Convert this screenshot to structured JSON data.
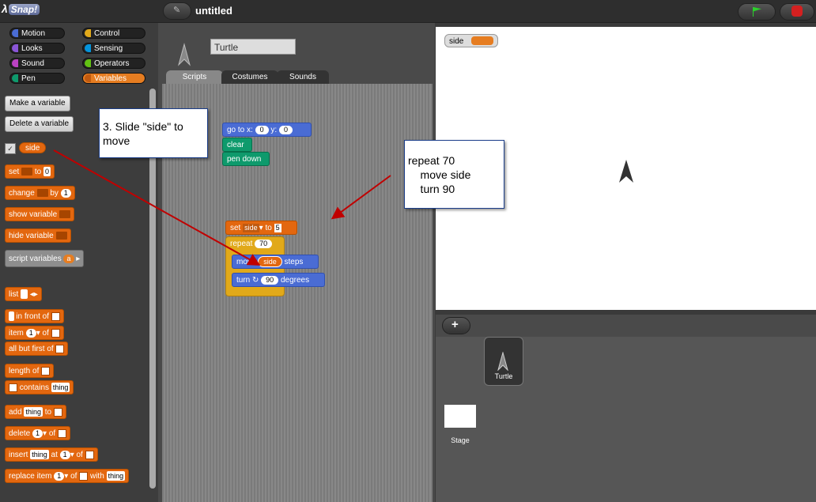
{
  "app": {
    "logo_text": "Snap!"
  },
  "toolbar": {
    "project_title": "untitled",
    "edit_icon_glyph": "✎"
  },
  "categories": [
    {
      "label": "Motion",
      "color": "#4a6cd4"
    },
    {
      "label": "Control",
      "color": "#e1a91a"
    },
    {
      "label": "Looks",
      "color": "#8a55d7"
    },
    {
      "label": "Sensing",
      "color": "#0494dc"
    },
    {
      "label": "Sound",
      "color": "#bb42c3"
    },
    {
      "label": "Operators",
      "color": "#62c213"
    },
    {
      "label": "Pen",
      "color": "#0e9a6c"
    },
    {
      "label": "Variables",
      "color": "#e67d21"
    }
  ],
  "palette": {
    "make_variable": "Make a variable",
    "delete_variable": "Delete a variable",
    "variable_name": "side",
    "check_mark": "✓",
    "set": "set",
    "set_to": "to",
    "set_value": "0",
    "change": "change",
    "change_by": "by",
    "change_value": "1",
    "show_variable": "show variable",
    "hide_variable": "hide variable",
    "script_variables": "script variables",
    "script_variables_arg": "a",
    "list": "list",
    "in_front_of": "in front of",
    "item": "item",
    "item_index": "1",
    "item_of": "of",
    "all_but_first_of": "all but first of",
    "length_of": "length of",
    "contains": "contains",
    "contains_arg": "thing",
    "add": "add",
    "add_arg": "thing",
    "add_to": "to",
    "delete": "delete",
    "delete_index": "1",
    "delete_of": "of",
    "insert": "insert",
    "insert_arg": "thing",
    "insert_at": "at",
    "insert_index": "1",
    "insert_of": "of",
    "replace_item": "replace item",
    "replace_index": "1",
    "replace_of": "of",
    "replace_with": "with",
    "replace_arg": "thing"
  },
  "sprite": {
    "name": "Turtle"
  },
  "tabs": [
    {
      "label": "Scripts",
      "selected": true
    },
    {
      "label": "Costumes",
      "selected": false
    },
    {
      "label": "Sounds",
      "selected": false
    }
  ],
  "scripts": {
    "goto": "go to x:",
    "goto_x": "0",
    "goto_y_label": "y:",
    "goto_y": "0",
    "clear": "clear",
    "pen_down": "pen down",
    "set": "set",
    "set_var": "side",
    "set_to": "to",
    "set_value": "5",
    "repeat": "repeat",
    "repeat_count": "70",
    "move": "move",
    "move_var": "side",
    "move_steps": "steps",
    "turn": "turn ↻",
    "turn_value": "90",
    "turn_degrees": "degrees"
  },
  "stage": {
    "watcher_label": "side",
    "watcher_color": "#e67d21"
  },
  "corral": {
    "sprite_label": "Turtle",
    "stage_label": "Stage",
    "add_glyph": "+"
  },
  "annotations": {
    "note1": "3. Slide \"side\" to\nmove",
    "note2": "repeat 70\n    move side\n    turn 90",
    "arrow_color": "#c00000"
  }
}
